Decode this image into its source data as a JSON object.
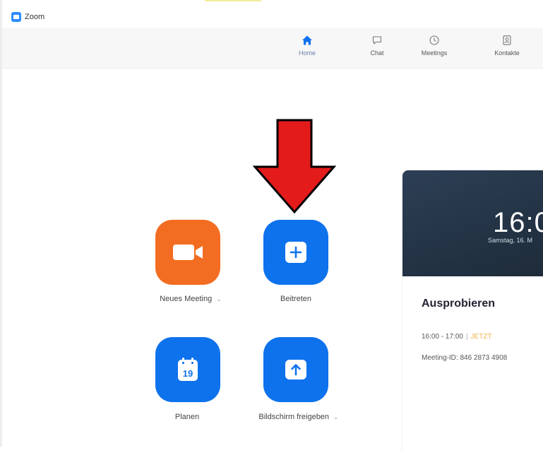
{
  "window": {
    "title": "Zoom"
  },
  "nav": {
    "tabs": [
      {
        "label": "Home",
        "icon": "home-icon",
        "active": true
      },
      {
        "label": "Chat",
        "icon": "chat-bubble-icon",
        "active": false
      },
      {
        "label": "Meetings",
        "icon": "clock-icon",
        "active": false
      },
      {
        "label": "Kontakte",
        "icon": "contacts-icon",
        "active": false
      }
    ]
  },
  "actions": {
    "new_meeting": {
      "label": "Neues Meeting",
      "icon": "video-camera-icon",
      "color": "#f26d21",
      "has_dropdown": true
    },
    "join": {
      "label": "Beitreten",
      "icon": "plus-icon",
      "color": "#0e72ed"
    },
    "schedule": {
      "label": "Planen",
      "icon": "calendar-icon",
      "calendar_day": "19",
      "color": "#0e72ed"
    },
    "share_screen": {
      "label": "Bildschirm freigeben",
      "icon": "share-up-arrow-icon",
      "color": "#0e72ed",
      "has_dropdown": true
    }
  },
  "annotation": {
    "icon": "red-down-arrow-icon",
    "color": "#e31b1b",
    "points_to": "join"
  },
  "meeting_card": {
    "time": "16:0",
    "date": "Samstag, 16. M",
    "title": "Ausprobieren",
    "slot": "16:00 - 17:00",
    "status": "JETZT",
    "meeting_id": "Meeting-ID: 846 2873 4908"
  },
  "colors": {
    "accent_blue": "#0e72ed",
    "accent_orange": "#f26d21",
    "now_badge": "#f0b14a",
    "card_header": "#2d3f55"
  }
}
